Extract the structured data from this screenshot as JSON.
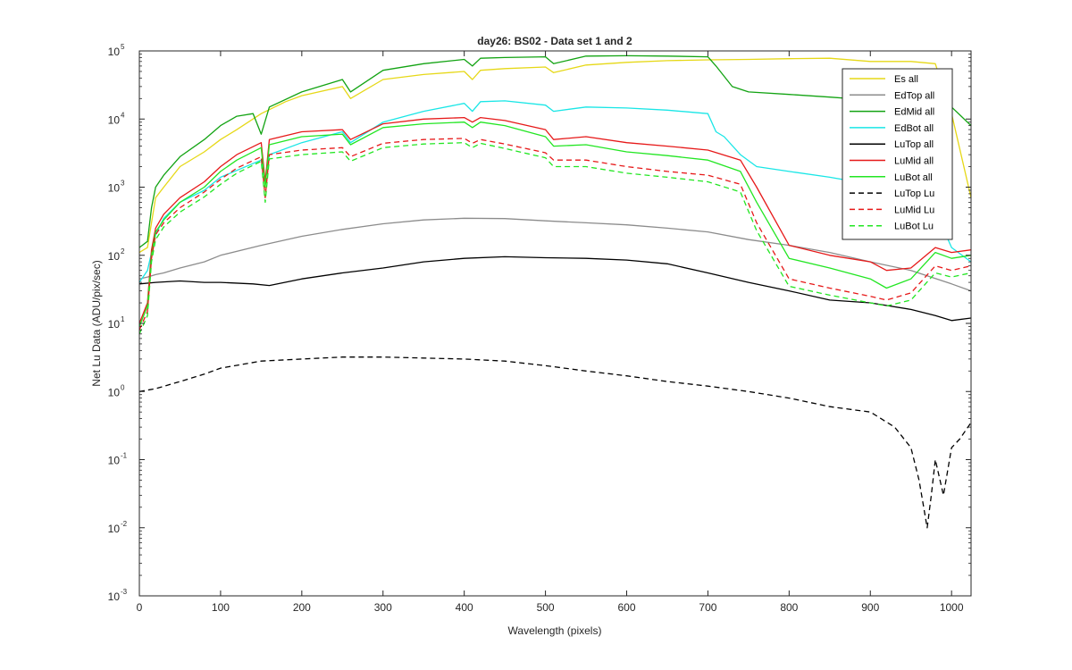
{
  "chart_data": {
    "type": "line",
    "title": "day26: BS02 - Data set 1 and 2",
    "xlabel": "Wavelength (pixels)",
    "ylabel": "Net Lu Data (ADU/pix/sec)",
    "xlim": [
      0,
      1024
    ],
    "ylim": [
      0.001,
      100000
    ],
    "yscale": "log",
    "grid": false,
    "legend_position": "top-right",
    "x_ticks": [
      0,
      100,
      200,
      300,
      400,
      500,
      600,
      700,
      800,
      900,
      1000
    ],
    "x_tick_labels": [
      "0",
      "100",
      "200",
      "300",
      "400",
      "500",
      "600",
      "700",
      "800",
      "900",
      "1000"
    ],
    "y_ticks": [
      {
        "value": 100000,
        "base": "10",
        "exp": "5"
      },
      {
        "value": 10000,
        "base": "10",
        "exp": "4"
      },
      {
        "value": 1000,
        "base": "10",
        "exp": "3"
      },
      {
        "value": 100,
        "base": "10",
        "exp": "2"
      },
      {
        "value": 10,
        "base": "10",
        "exp": "1"
      },
      {
        "value": 1,
        "base": "10",
        "exp": "0"
      },
      {
        "value": 0.1,
        "base": "10",
        "exp": "-1"
      },
      {
        "value": 0.01,
        "base": "10",
        "exp": "-2"
      },
      {
        "value": 0.001,
        "base": "10",
        "exp": "-3"
      }
    ],
    "series": [
      {
        "name": "Es  all",
        "color": "#e6d817",
        "dash": "solid",
        "x": [
          0,
          10,
          15,
          20,
          30,
          50,
          80,
          100,
          120,
          150,
          180,
          200,
          250,
          260,
          300,
          350,
          400,
          410,
          420,
          450,
          500,
          510,
          550,
          600,
          650,
          700,
          750,
          800,
          850,
          900,
          950,
          980,
          1000,
          1024
        ],
        "y": [
          110,
          130,
          300,
          700,
          1000,
          2000,
          3300,
          5000,
          7000,
          12000,
          18000,
          22000,
          30000,
          20000,
          38000,
          45000,
          50000,
          38000,
          52000,
          55000,
          58000,
          48000,
          62000,
          68000,
          72000,
          74000,
          75000,
          77000,
          78000,
          70000,
          70000,
          65000,
          12000,
          700
        ]
      },
      {
        "name": "EdTop  all",
        "color": "#8c8c8c",
        "dash": "solid",
        "x": [
          0,
          10,
          20,
          30,
          50,
          80,
          100,
          150,
          200,
          250,
          300,
          350,
          400,
          450,
          500,
          550,
          600,
          650,
          700,
          750,
          800,
          850,
          900,
          950,
          1000,
          1024
        ],
        "y": [
          45,
          48,
          52,
          55,
          65,
          80,
          100,
          140,
          190,
          240,
          290,
          330,
          350,
          345,
          320,
          300,
          280,
          250,
          220,
          170,
          140,
          110,
          80,
          60,
          38,
          30
        ]
      },
      {
        "name": "EdMid  all",
        "color": "#12a312",
        "dash": "solid",
        "x": [
          0,
          10,
          15,
          20,
          30,
          50,
          80,
          100,
          120,
          140,
          150,
          160,
          200,
          250,
          260,
          300,
          350,
          400,
          410,
          420,
          450,
          500,
          510,
          550,
          600,
          650,
          700,
          710,
          730,
          750,
          800,
          850,
          900,
          950,
          1000,
          1024
        ],
        "y": [
          130,
          160,
          500,
          1000,
          1500,
          2800,
          5000,
          8000,
          11000,
          12000,
          6000,
          15000,
          25000,
          38000,
          25000,
          52000,
          65000,
          75000,
          60000,
          78000,
          80000,
          82000,
          65000,
          84000,
          85000,
          84000,
          82000,
          60000,
          30000,
          25000,
          23000,
          21000,
          19000,
          17000,
          15000,
          8000
        ]
      },
      {
        "name": "EdBot  all",
        "color": "#19e6e6",
        "dash": "solid",
        "x": [
          0,
          10,
          20,
          30,
          50,
          80,
          100,
          150,
          155,
          160,
          200,
          250,
          260,
          300,
          350,
          400,
          410,
          420,
          450,
          500,
          510,
          550,
          600,
          650,
          700,
          710,
          720,
          740,
          760,
          800,
          850,
          900,
          950,
          980,
          1000,
          1024
        ],
        "y": [
          40,
          60,
          200,
          350,
          600,
          900,
          1400,
          2500,
          1200,
          3000,
          4500,
          6500,
          4500,
          9000,
          13000,
          17000,
          13000,
          18000,
          18500,
          16000,
          13000,
          15000,
          14500,
          13500,
          12000,
          6500,
          5500,
          3000,
          2000,
          1700,
          1400,
          1100,
          600,
          450,
          130,
          80
        ]
      },
      {
        "name": "LuTop  all",
        "color": "#000000",
        "dash": "solid",
        "x": [
          0,
          20,
          50,
          80,
          100,
          140,
          160,
          200,
          250,
          300,
          350,
          400,
          450,
          500,
          550,
          600,
          650,
          700,
          750,
          800,
          850,
          900,
          950,
          980,
          1000,
          1024
        ],
        "y": [
          38,
          40,
          42,
          40,
          40,
          38,
          36,
          45,
          55,
          65,
          80,
          90,
          95,
          92,
          90,
          85,
          75,
          55,
          40,
          30,
          22,
          20,
          16,
          13,
          11,
          12
        ]
      },
      {
        "name": "LuMid  all",
        "color": "#e61919",
        "dash": "solid",
        "x": [
          0,
          10,
          15,
          20,
          30,
          50,
          80,
          100,
          120,
          150,
          155,
          160,
          200,
          250,
          260,
          300,
          350,
          400,
          410,
          420,
          450,
          500,
          510,
          550,
          600,
          650,
          700,
          740,
          760,
          800,
          850,
          900,
          920,
          950,
          980,
          1000,
          1024
        ],
        "y": [
          10,
          20,
          120,
          250,
          400,
          700,
          1200,
          2000,
          3000,
          4500,
          1200,
          5000,
          6500,
          7000,
          5000,
          8500,
          10000,
          10500,
          9000,
          10500,
          9500,
          7000,
          5000,
          5500,
          4500,
          4000,
          3500,
          2500,
          1000,
          140,
          100,
          80,
          60,
          65,
          130,
          110,
          120
        ]
      },
      {
        "name": "LuBot  all",
        "color": "#22e622",
        "dash": "solid",
        "x": [
          0,
          10,
          15,
          20,
          30,
          50,
          80,
          100,
          120,
          150,
          155,
          160,
          200,
          250,
          260,
          300,
          350,
          400,
          410,
          420,
          450,
          500,
          510,
          550,
          600,
          650,
          700,
          740,
          760,
          800,
          850,
          900,
          920,
          950,
          980,
          1000,
          1024
        ],
        "y": [
          9,
          18,
          100,
          220,
          330,
          600,
          1000,
          1700,
          2500,
          3800,
          1000,
          4200,
          5500,
          6000,
          4200,
          7500,
          8500,
          9000,
          7500,
          9000,
          8000,
          5500,
          4000,
          4200,
          3300,
          2900,
          2500,
          1700,
          600,
          90,
          65,
          45,
          33,
          45,
          110,
          90,
          100
        ]
      },
      {
        "name": "LuTop  Lu",
        "color": "#000000",
        "dash": "dashed",
        "x": [
          0,
          20,
          50,
          80,
          100,
          150,
          200,
          250,
          300,
          350,
          400,
          450,
          500,
          550,
          600,
          650,
          700,
          750,
          800,
          850,
          900,
          930,
          950,
          960,
          970,
          975,
          980,
          990,
          1000,
          1010,
          1024
        ],
        "y": [
          1.0,
          1.1,
          1.4,
          1.8,
          2.2,
          2.8,
          3.0,
          3.2,
          3.2,
          3.1,
          3.0,
          2.8,
          2.4,
          2.0,
          1.7,
          1.4,
          1.2,
          1.0,
          0.8,
          0.6,
          0.5,
          0.3,
          0.15,
          0.05,
          0.01,
          0.03,
          0.1,
          0.03,
          0.15,
          0.2,
          0.35
        ]
      },
      {
        "name": "LuMid  Lu",
        "color": "#e61919",
        "dash": "dashed",
        "x": [
          0,
          10,
          15,
          20,
          30,
          50,
          80,
          100,
          120,
          150,
          155,
          160,
          200,
          250,
          260,
          300,
          350,
          400,
          410,
          420,
          450,
          500,
          510,
          550,
          600,
          650,
          700,
          740,
          760,
          800,
          850,
          900,
          920,
          950,
          980,
          1000,
          1024
        ],
        "y": [
          8,
          15,
          90,
          200,
          300,
          500,
          850,
          1300,
          1900,
          2800,
          700,
          3000,
          3500,
          3800,
          2800,
          4400,
          5000,
          5200,
          4400,
          5000,
          4300,
          3200,
          2500,
          2500,
          2000,
          1700,
          1500,
          1100,
          300,
          45,
          33,
          25,
          22,
          28,
          70,
          60,
          70
        ]
      },
      {
        "name": "LuBot  Lu",
        "color": "#22e622",
        "dash": "dashed",
        "x": [
          0,
          10,
          15,
          20,
          30,
          50,
          80,
          100,
          120,
          150,
          155,
          160,
          200,
          250,
          260,
          300,
          350,
          400,
          410,
          420,
          450,
          500,
          510,
          550,
          600,
          650,
          700,
          740,
          760,
          800,
          850,
          900,
          920,
          950,
          980,
          1000,
          1024
        ],
        "y": [
          7,
          13,
          80,
          170,
          260,
          430,
          720,
          1100,
          1600,
          2400,
          600,
          2600,
          3000,
          3300,
          2400,
          3800,
          4300,
          4500,
          3800,
          4400,
          3700,
          2700,
          2000,
          2000,
          1600,
          1400,
          1200,
          850,
          230,
          35,
          26,
          20,
          18,
          22,
          55,
          48,
          55
        ]
      }
    ]
  }
}
